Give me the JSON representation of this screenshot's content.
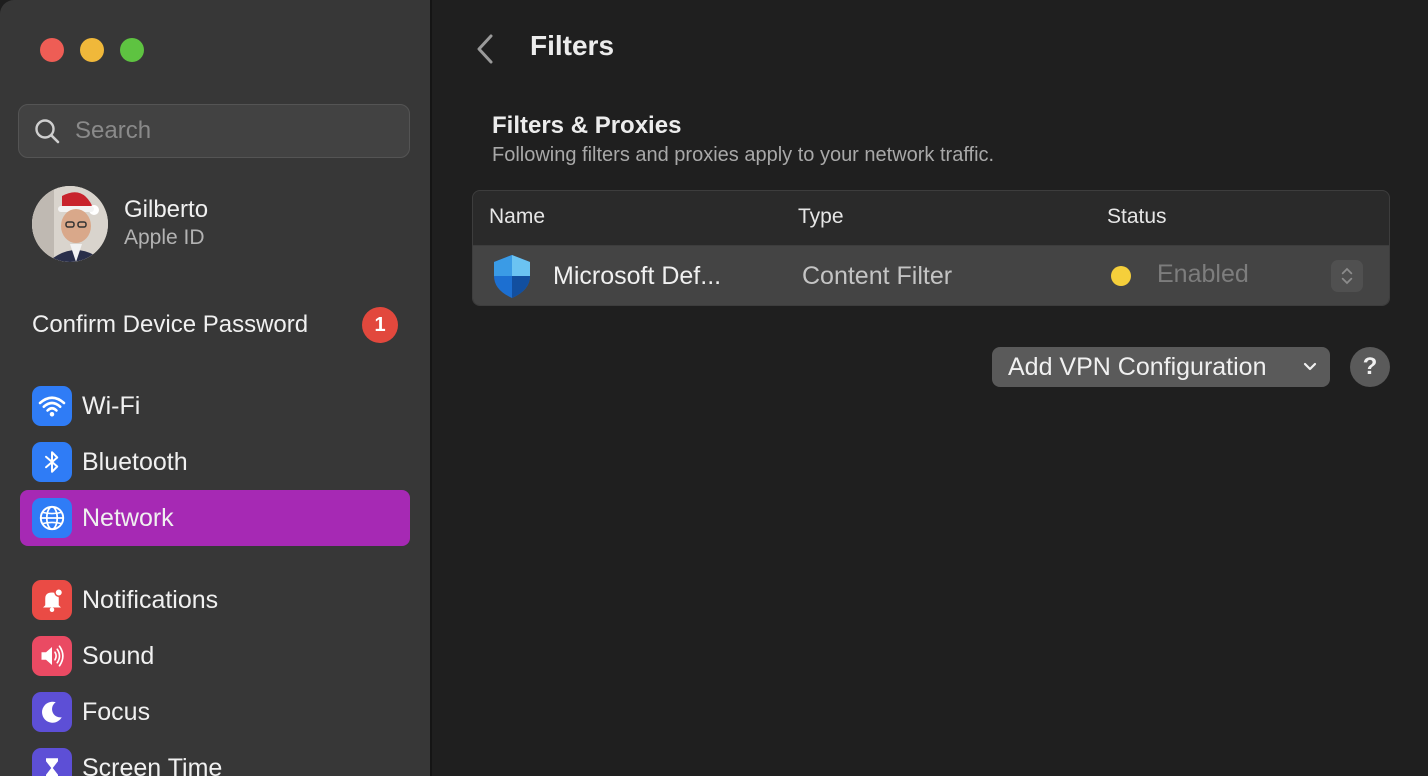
{
  "sidebar": {
    "search_placeholder": "Search",
    "profile": {
      "name": "Gilberto",
      "subtitle": "Apple ID"
    },
    "confirm": {
      "label": "Confirm Device Password",
      "badge": "1"
    },
    "items": [
      {
        "label": "Wi-Fi",
        "icon": "wifi-icon",
        "color": "#2f7cf6"
      },
      {
        "label": "Bluetooth",
        "icon": "bluetooth-icon",
        "color": "#2f7cf6"
      },
      {
        "label": "Network",
        "icon": "globe-icon",
        "color": "#2f7cf6",
        "active": true
      },
      {
        "label": "Notifications",
        "icon": "bell-icon",
        "color": "#ea4b45"
      },
      {
        "label": "Sound",
        "icon": "speaker-icon",
        "color": "#ea4a63"
      },
      {
        "label": "Focus",
        "icon": "moon-icon",
        "color": "#5d4fd6"
      },
      {
        "label": "Screen Time",
        "icon": "hourglass-icon",
        "color": "#5d4fd6"
      }
    ]
  },
  "main": {
    "title": "Filters",
    "section_title": "Filters & Proxies",
    "section_desc": "Following filters and proxies apply to your network traffic.",
    "table": {
      "headers": [
        "Name",
        "Type",
        "Status"
      ],
      "rows": [
        {
          "name": "Microsoft Def...",
          "type": "Content Filter",
          "status": "Enabled",
          "status_color": "#f5cf3b"
        }
      ]
    },
    "add_vpn_label": "Add VPN Configuration",
    "help_label": "?"
  },
  "colors": {
    "accent": "#a629b4",
    "badge": "#e2483d"
  }
}
